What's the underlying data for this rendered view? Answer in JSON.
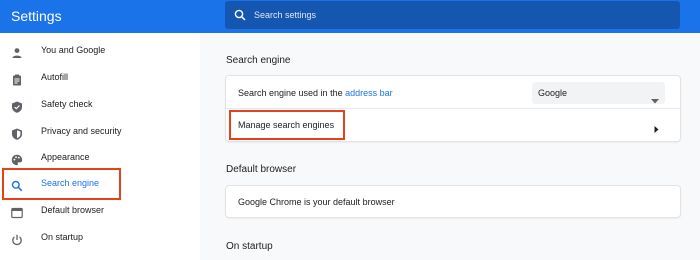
{
  "header": {
    "title": "Settings",
    "search_placeholder": "Search settings"
  },
  "sidebar": {
    "items": [
      {
        "label": "You and Google",
        "icon": "person-icon"
      },
      {
        "label": "Autofill",
        "icon": "clipboard-icon"
      },
      {
        "label": "Safety check",
        "icon": "shield-check-icon"
      },
      {
        "label": "Privacy and security",
        "icon": "shield-lock-icon"
      },
      {
        "label": "Appearance",
        "icon": "palette-icon"
      },
      {
        "label": "Search engine",
        "icon": "search-icon",
        "active": true
      },
      {
        "label": "Default browser",
        "icon": "browser-window-icon"
      },
      {
        "label": "On startup",
        "icon": "power-icon"
      }
    ]
  },
  "main": {
    "search_engine": {
      "title": "Search engine",
      "used_in_prefix": "Search engine used in the ",
      "used_in_link": "address bar",
      "selected_engine": "Google",
      "manage_label": "Manage search engines"
    },
    "default_browser": {
      "title": "Default browser",
      "status": "Google Chrome is your default browser"
    },
    "on_startup": {
      "title": "On startup"
    }
  },
  "colors": {
    "accent": "#1a73e8",
    "header_search_bg": "#1557b0",
    "highlight": "#e8401c"
  }
}
